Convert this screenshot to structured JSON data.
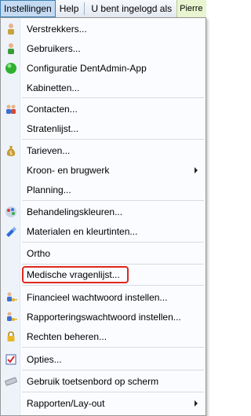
{
  "menubar": {
    "instellingen": "Instellingen",
    "help": "Help",
    "status": "U bent ingelogd als",
    "user": "Pierre"
  },
  "menu": {
    "items": [
      {
        "label": "Verstrekkers...",
        "icon": "person-icon"
      },
      {
        "label": "Gebruikers...",
        "icon": "user-icon"
      },
      {
        "label": "Configuratie DentAdmin-App",
        "icon": "green-circle-icon"
      },
      {
        "label": "Kabinetten...",
        "icon": ""
      },
      {
        "label": "Contacten...",
        "icon": "contacts-icon"
      },
      {
        "label": "Stratenlijst...",
        "icon": ""
      },
      {
        "label": "Tarieven...",
        "icon": "money-bag-icon"
      },
      {
        "label": "Kroon- en brugwerk",
        "icon": "",
        "submenu": true
      },
      {
        "label": "Planning...",
        "icon": ""
      },
      {
        "label": "Behandelingskleuren...",
        "icon": "palette-icon"
      },
      {
        "label": "Materialen en kleurtinten...",
        "icon": "brush-icon"
      },
      {
        "label": "Ortho",
        "icon": ""
      },
      {
        "label": "Medische vragenlijst...",
        "icon": ""
      },
      {
        "label": "Financieel wachtwoord instellen...",
        "icon": "key-user-icon"
      },
      {
        "label": "Rapporteringswachtwoord instellen...",
        "icon": "key-user-icon"
      },
      {
        "label": "Rechten beheren...",
        "icon": "lock-icon"
      },
      {
        "label": "Opties...",
        "icon": "checklist-icon"
      },
      {
        "label": "Gebruik toetsenbord op scherm",
        "icon": "keyboard-icon"
      },
      {
        "label": "Rapporten/Lay-out",
        "icon": "",
        "submenu": true
      }
    ]
  },
  "colors": {
    "accent": "#3c7fb1",
    "highlight": "#e0281e"
  }
}
